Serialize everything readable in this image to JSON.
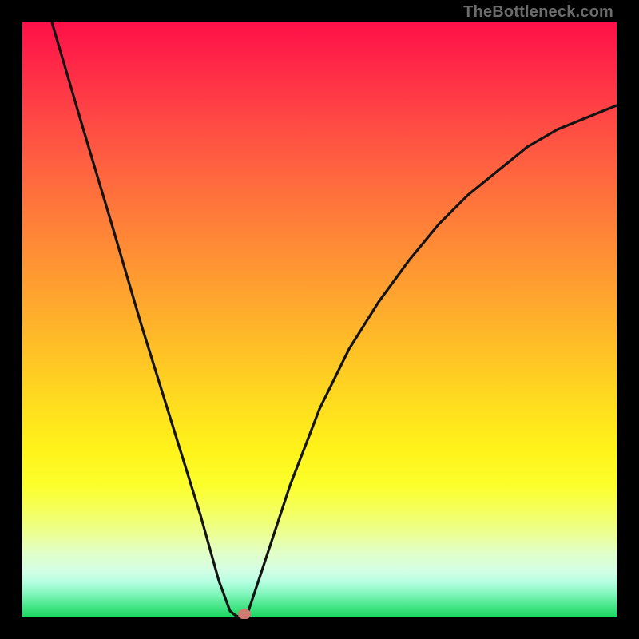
{
  "attribution": "TheBottleneck.com",
  "colors": {
    "frame": "#000000",
    "curve_stroke": "#141414",
    "marker_fill": "#cf7b72"
  },
  "chart_data": {
    "type": "line",
    "title": "",
    "xlabel": "",
    "ylabel": "",
    "xlim": [
      0,
      100
    ],
    "ylim": [
      0,
      100
    ],
    "x": [
      5,
      10,
      15,
      20,
      25,
      30,
      33,
      35,
      36,
      37,
      38,
      40,
      45,
      50,
      55,
      60,
      65,
      70,
      75,
      80,
      85,
      90,
      95,
      100
    ],
    "values": [
      100,
      83,
      66,
      49,
      33,
      17,
      6,
      1,
      0,
      0,
      1,
      7,
      22,
      35,
      45,
      53,
      60,
      66,
      71,
      75,
      79,
      82,
      84,
      86
    ],
    "marker": {
      "x": 37,
      "y": 0
    },
    "gradient_background": true
  }
}
